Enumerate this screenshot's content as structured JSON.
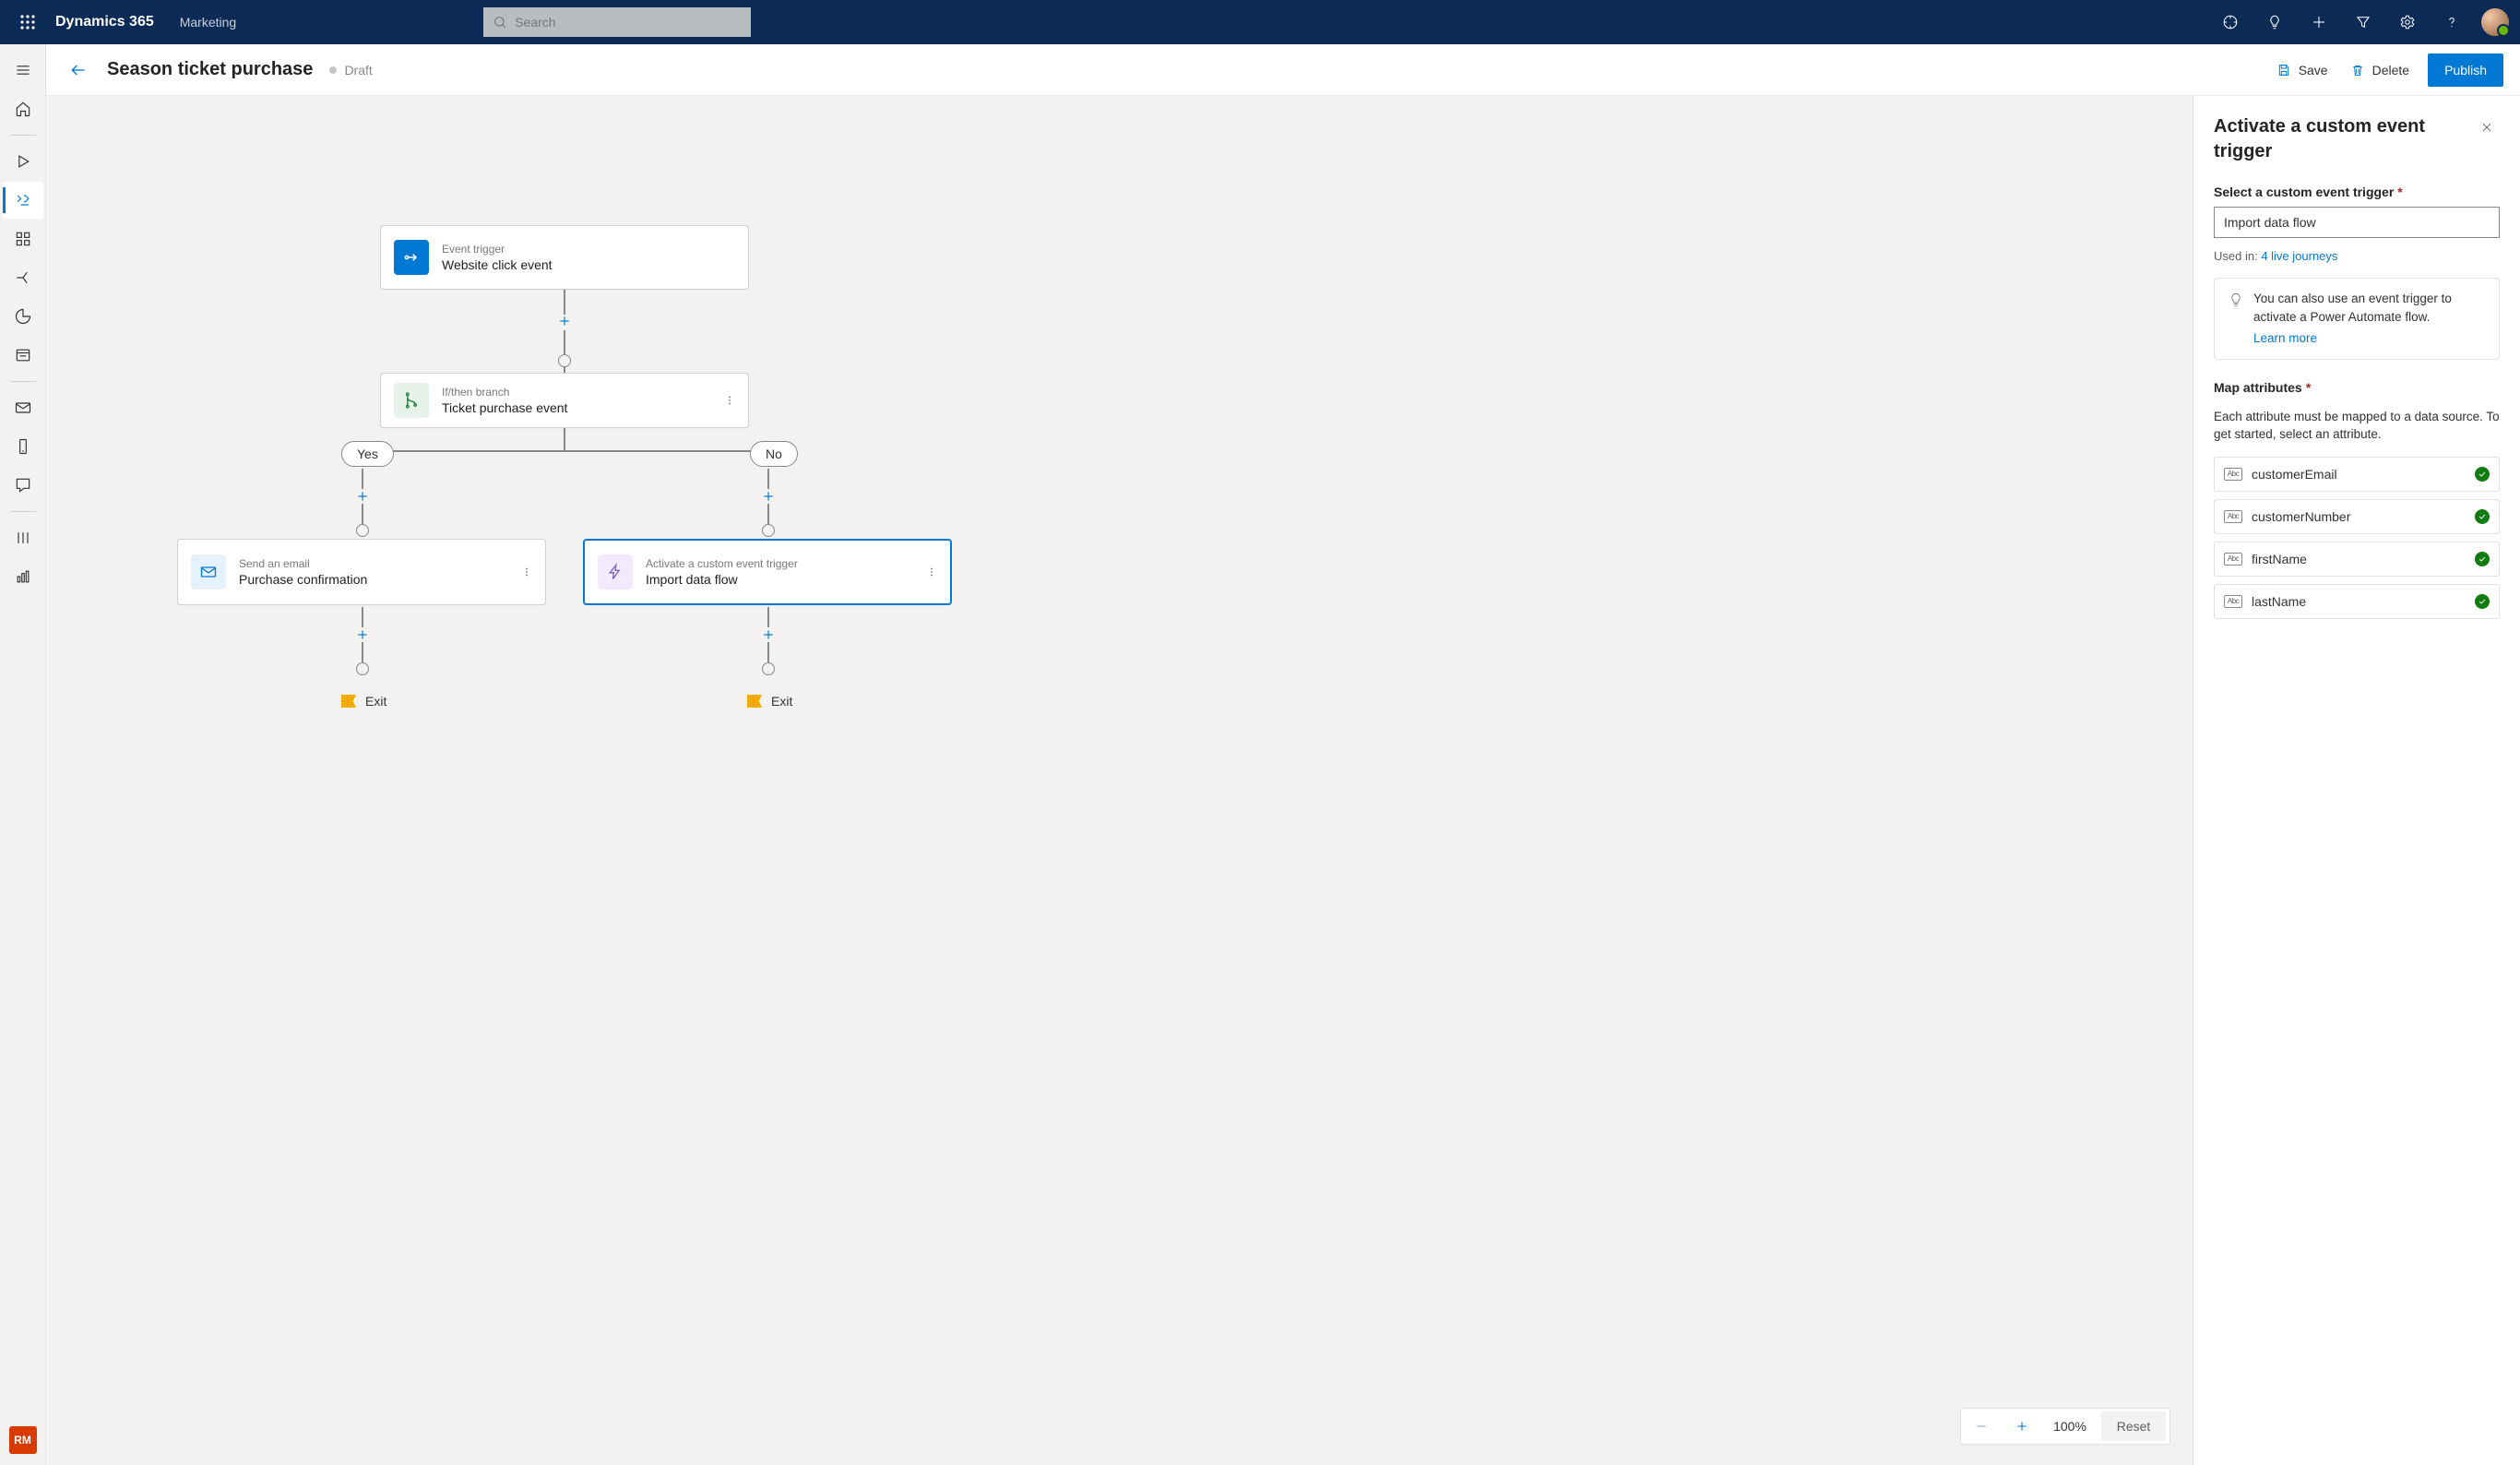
{
  "header": {
    "brand": "Dynamics 365",
    "brand_sub": "Marketing",
    "search_placeholder": "Search"
  },
  "page": {
    "title": "Season ticket purchase",
    "status": "Draft",
    "save_label": "Save",
    "delete_label": "Delete",
    "publish_label": "Publish"
  },
  "leftrail": {
    "badge": "RM"
  },
  "nodes": {
    "trigger": {
      "label": "Event trigger",
      "title": "Website click event"
    },
    "branch": {
      "label": "If/then branch",
      "title": "Ticket purchase event",
      "yes": "Yes",
      "no": "No"
    },
    "email": {
      "label": "Send an email",
      "title": "Purchase confirmation"
    },
    "custom": {
      "label": "Activate a custom event trigger",
      "title": "Import data flow"
    },
    "exit": "Exit"
  },
  "zoom": {
    "value": "100%",
    "reset": "Reset"
  },
  "panel": {
    "title": "Activate a custom event trigger",
    "select_label": "Select a custom event trigger",
    "select_value": "Import data flow",
    "used_in_prefix": "Used in: ",
    "used_in_link": "4 live journeys",
    "tip_text": "You can also use an event trigger to activate a Power Automate flow.",
    "tip_link": "Learn more",
    "map_label": "Map attributes",
    "map_sub": "Each attribute must be mapped to a data source. To get started, select an attribute.",
    "attributes": [
      {
        "name": "customerEmail"
      },
      {
        "name": "customerNumber"
      },
      {
        "name": "firstName"
      },
      {
        "name": "lastName"
      }
    ]
  }
}
